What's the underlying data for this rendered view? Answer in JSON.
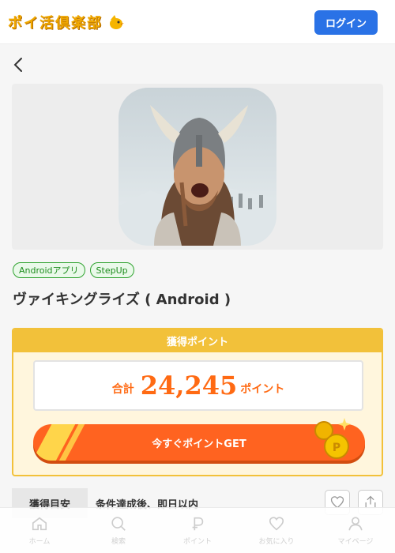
{
  "header": {
    "logo_text": "ポイ活倶楽部",
    "login_label": "ログイン"
  },
  "tags": [
    "Androidアプリ",
    "StepUp"
  ],
  "app": {
    "title": "ヴァイキングライズ ( Android )"
  },
  "points": {
    "header": "獲得ポイント",
    "total_label": "合計",
    "total_value": "24,245",
    "unit": "ポイント",
    "cta_label": "今すぐポイントGET"
  },
  "info": {
    "label": "獲得目安",
    "value": "条件達成後、即日以内"
  },
  "nav": {
    "items": [
      {
        "label": "ホーム",
        "icon": "home-icon"
      },
      {
        "label": "検索",
        "icon": "search-icon"
      },
      {
        "label": "ポイント",
        "icon": "point-icon"
      },
      {
        "label": "お気に入り",
        "icon": "heart-icon"
      },
      {
        "label": "マイページ",
        "icon": "user-icon"
      }
    ]
  },
  "colors": {
    "accent": "#ff6320",
    "brand_blue": "#2a72e6",
    "gold": "#f2c13a",
    "tag_green": "#2fa32f"
  }
}
